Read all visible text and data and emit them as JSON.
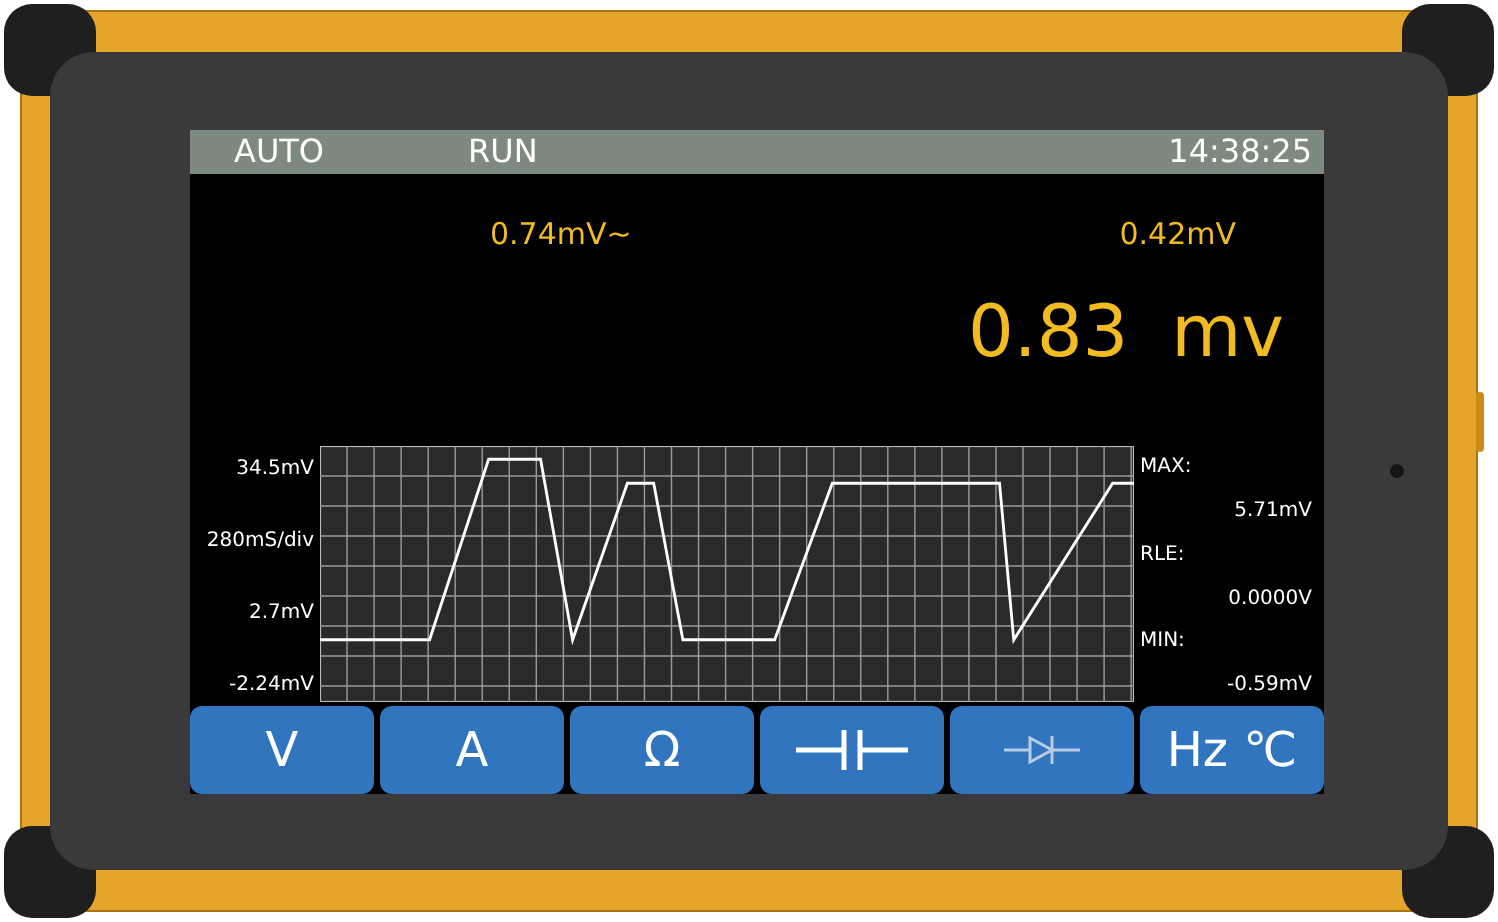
{
  "status_bar": {
    "mode": "AUTO",
    "state": "RUN",
    "time": "14:38:25"
  },
  "readings": {
    "ac": "0.74mV~",
    "dc": "0.42mV",
    "main": "0.83 mv"
  },
  "scope": {
    "left_labels": [
      "34.5mV",
      "280mS/div",
      "2.7mV",
      "-2.24mV"
    ],
    "right_labels": [
      "MAX:",
      "5.71mV",
      "RLE:",
      "0.0000V",
      "MIN:",
      "-0.59mV"
    ]
  },
  "buttons": [
    {
      "kind": "text",
      "label": "V",
      "disabled": false
    },
    {
      "kind": "text",
      "label": "A",
      "disabled": false
    },
    {
      "kind": "text",
      "label": "Ω",
      "disabled": false
    },
    {
      "kind": "capacitor",
      "disabled": false
    },
    {
      "kind": "diode",
      "disabled": true
    },
    {
      "kind": "text",
      "label": "Hz ℃",
      "disabled": false
    }
  ]
}
